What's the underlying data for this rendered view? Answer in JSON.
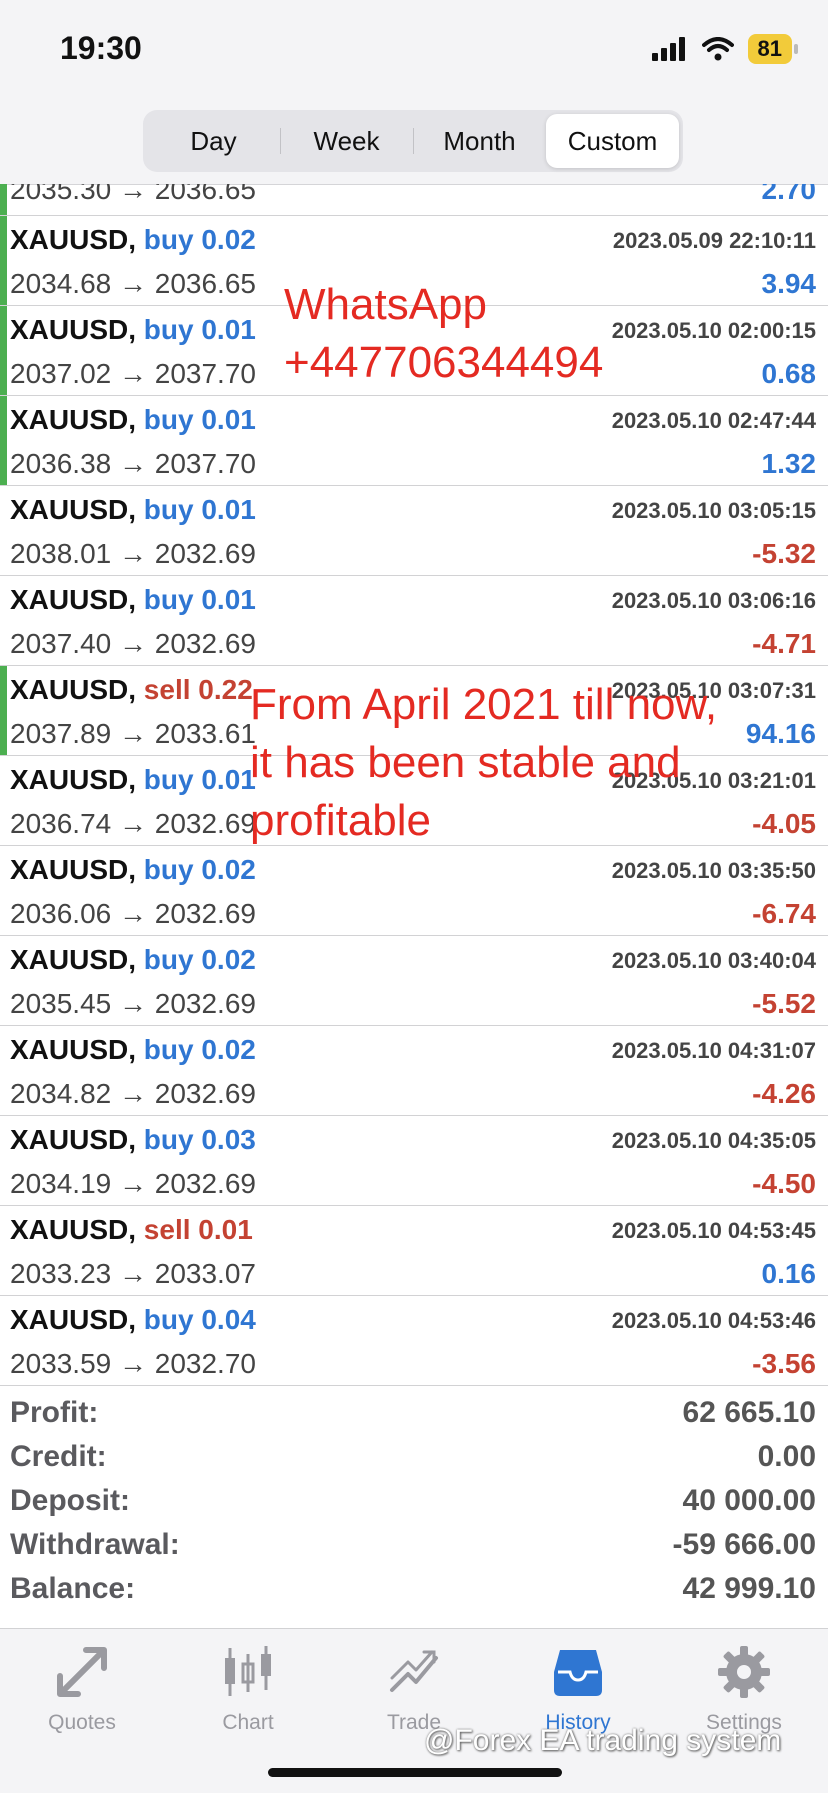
{
  "status": {
    "time": "19:30",
    "battery": "81"
  },
  "period_tabs": [
    "Day",
    "Week",
    "Month",
    "Custom"
  ],
  "partial_row": {
    "prices": "2035.30 → 2036.65",
    "pnl": "2.70"
  },
  "deals": [
    {
      "symbol": "XAUUSD,",
      "side": "buy",
      "volume": "0.02",
      "date": "2023.05.09 22:10:11",
      "prices": "2034.68 → 2036.65",
      "pnl": "3.94",
      "bar": true
    },
    {
      "symbol": "XAUUSD,",
      "side": "buy",
      "volume": "0.01",
      "date": "2023.05.10 02:00:15",
      "prices": "2037.02 → 2037.70",
      "pnl": "0.68",
      "bar": true
    },
    {
      "symbol": "XAUUSD,",
      "side": "buy",
      "volume": "0.01",
      "date": "2023.05.10 02:47:44",
      "prices": "2036.38 → 2037.70",
      "pnl": "1.32",
      "bar": true
    },
    {
      "symbol": "XAUUSD,",
      "side": "buy",
      "volume": "0.01",
      "date": "2023.05.10 03:05:15",
      "prices": "2038.01 → 2032.69",
      "pnl": "-5.32",
      "bar": false
    },
    {
      "symbol": "XAUUSD,",
      "side": "buy",
      "volume": "0.01",
      "date": "2023.05.10 03:06:16",
      "prices": "2037.40 → 2032.69",
      "pnl": "-4.71",
      "bar": false
    },
    {
      "symbol": "XAUUSD,",
      "side": "sell",
      "volume": "0.22",
      "date": "2023.05.10 03:07:31",
      "prices": "2037.89 → 2033.61",
      "pnl": "94.16",
      "bar": true
    },
    {
      "symbol": "XAUUSD,",
      "side": "buy",
      "volume": "0.01",
      "date": "2023.05.10 03:21:01",
      "prices": "2036.74 → 2032.69",
      "pnl": "-4.05",
      "bar": false
    },
    {
      "symbol": "XAUUSD,",
      "side": "buy",
      "volume": "0.02",
      "date": "2023.05.10 03:35:50",
      "prices": "2036.06 → 2032.69",
      "pnl": "-6.74",
      "bar": false
    },
    {
      "symbol": "XAUUSD,",
      "side": "buy",
      "volume": "0.02",
      "date": "2023.05.10 03:40:04",
      "prices": "2035.45 → 2032.69",
      "pnl": "-5.52",
      "bar": false
    },
    {
      "symbol": "XAUUSD,",
      "side": "buy",
      "volume": "0.02",
      "date": "2023.05.10 04:31:07",
      "prices": "2034.82 → 2032.69",
      "pnl": "-4.26",
      "bar": false
    },
    {
      "symbol": "XAUUSD,",
      "side": "buy",
      "volume": "0.03",
      "date": "2023.05.10 04:35:05",
      "prices": "2034.19 → 2032.69",
      "pnl": "-4.50",
      "bar": false
    },
    {
      "symbol": "XAUUSD,",
      "side": "sell",
      "volume": "0.01",
      "date": "2023.05.10 04:53:45",
      "prices": "2033.23 → 2033.07",
      "pnl": "0.16",
      "bar": false
    },
    {
      "symbol": "XAUUSD,",
      "side": "buy",
      "volume": "0.04",
      "date": "2023.05.10 04:53:46",
      "prices": "2033.59 → 2032.70",
      "pnl": "-3.56",
      "bar": false
    }
  ],
  "summary": [
    {
      "label": "Profit:",
      "value": "62 665.10"
    },
    {
      "label": "Credit:",
      "value": "0.00"
    },
    {
      "label": "Deposit:",
      "value": "40 000.00"
    },
    {
      "label": "Withdrawal:",
      "value": "-59 666.00"
    },
    {
      "label": "Balance:",
      "value": "42 999.10"
    }
  ],
  "tabs": [
    {
      "label": "Quotes",
      "icon": "quotes-icon",
      "active": false
    },
    {
      "label": "Chart",
      "icon": "chart-icon",
      "active": false
    },
    {
      "label": "Trade",
      "icon": "trade-icon",
      "active": false
    },
    {
      "label": "History",
      "icon": "history-icon",
      "active": true
    },
    {
      "label": "Settings",
      "icon": "settings-icon",
      "active": false
    }
  ],
  "overlays": {
    "contact": "WhatsApp\n+447706344494",
    "claim": "From April 2021 till now,\nit has been stable and\nprofitable"
  },
  "watermark": "@Forex EA trading system",
  "colors": {
    "buy": "#2f76d2",
    "sell": "#c44232",
    "overlay": "#e42a22",
    "bar": "#4caf50"
  }
}
